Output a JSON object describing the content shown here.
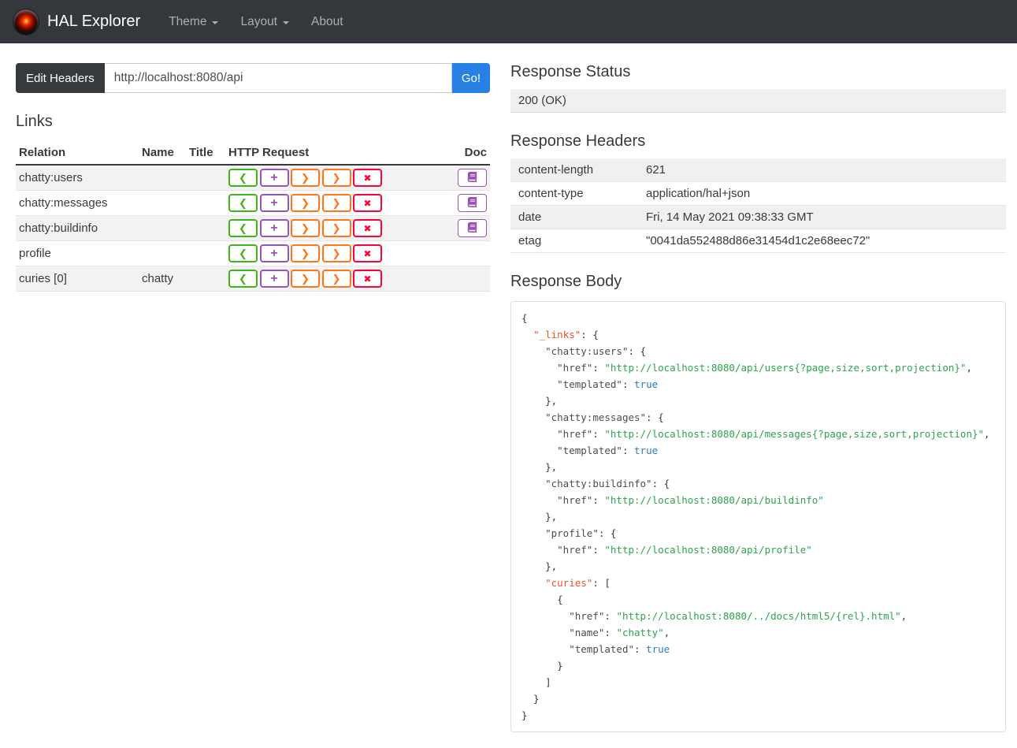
{
  "navbar": {
    "brand": "HAL Explorer",
    "items": [
      {
        "label": "Theme",
        "has_caret": true
      },
      {
        "label": "Layout",
        "has_caret": true
      },
      {
        "label": "About",
        "has_caret": false
      }
    ]
  },
  "url_bar": {
    "edit_headers_label": "Edit Headers",
    "url_value": "http://localhost:8080/api",
    "go_label": "Go!"
  },
  "links_section": {
    "title": "Links",
    "columns": {
      "relation": "Relation",
      "name": "Name",
      "title": "Title",
      "http_request": "HTTP Request",
      "doc": "Doc"
    },
    "request_buttons": [
      {
        "name": "get",
        "glyph": "❮",
        "color": "#3fb618"
      },
      {
        "name": "post",
        "glyph": "+",
        "color": "#9954bb"
      },
      {
        "name": "put",
        "glyph": "❯",
        "color": "#ff7518"
      },
      {
        "name": "patch",
        "glyph": "❯",
        "color": "#ff7518"
      },
      {
        "name": "delete",
        "glyph": "✖",
        "color": "#ff0039"
      }
    ],
    "doc_button": {
      "icon": "book-icon",
      "color": "#9954bb"
    },
    "rows": [
      {
        "relation": "chatty:users",
        "name": "",
        "title": "",
        "has_doc": true
      },
      {
        "relation": "chatty:messages",
        "name": "",
        "title": "",
        "has_doc": true
      },
      {
        "relation": "chatty:buildinfo",
        "name": "",
        "title": "",
        "has_doc": true
      },
      {
        "relation": "profile",
        "name": "",
        "title": "",
        "has_doc": false
      },
      {
        "relation": "curies [0]",
        "name": "chatty",
        "title": "",
        "has_doc": false
      }
    ]
  },
  "response_status": {
    "title": "Response Status",
    "value": "200 (OK)"
  },
  "response_headers": {
    "title": "Response Headers",
    "rows": [
      [
        "content-length",
        "621"
      ],
      [
        "content-type",
        "application/hal+json"
      ],
      [
        "date",
        "Fri, 14 May 2021 09:38:33 GMT"
      ],
      [
        "etag",
        "\"0041da552488d86e31454d1c2e68eec72\""
      ]
    ]
  },
  "response_body": {
    "title": "Response Body",
    "lines": [
      [
        [
          "p",
          "{"
        ]
      ],
      [
        [
          "p",
          "  "
        ],
        [
          "h",
          "\"_links\""
        ],
        [
          "p",
          ": {"
        ]
      ],
      [
        [
          "p",
          "    "
        ],
        [
          "k",
          "\"chatty:users\""
        ],
        [
          "p",
          ": {"
        ]
      ],
      [
        [
          "p",
          "      "
        ],
        [
          "k",
          "\"href\""
        ],
        [
          "p",
          ": "
        ],
        [
          "s",
          "\"http://localhost:8080/api/users{?page,size,sort,projection}\""
        ],
        [
          "p",
          ","
        ]
      ],
      [
        [
          "p",
          "      "
        ],
        [
          "k",
          "\"templated\""
        ],
        [
          "p",
          ": "
        ],
        [
          "b",
          "true"
        ]
      ],
      [
        [
          "p",
          "    },"
        ]
      ],
      [
        [
          "p",
          "    "
        ],
        [
          "k",
          "\"chatty:messages\""
        ],
        [
          "p",
          ": {"
        ]
      ],
      [
        [
          "p",
          "      "
        ],
        [
          "k",
          "\"href\""
        ],
        [
          "p",
          ": "
        ],
        [
          "s",
          "\"http://localhost:8080/api/messages{?page,size,sort,projection}\""
        ],
        [
          "p",
          ","
        ]
      ],
      [
        [
          "p",
          "      "
        ],
        [
          "k",
          "\"templated\""
        ],
        [
          "p",
          ": "
        ],
        [
          "b",
          "true"
        ]
      ],
      [
        [
          "p",
          "    },"
        ]
      ],
      [
        [
          "p",
          "    "
        ],
        [
          "k",
          "\"chatty:buildinfo\""
        ],
        [
          "p",
          ": {"
        ]
      ],
      [
        [
          "p",
          "      "
        ],
        [
          "k",
          "\"href\""
        ],
        [
          "p",
          ": "
        ],
        [
          "s",
          "\"http://localhost:8080/api/buildinfo\""
        ]
      ],
      [
        [
          "p",
          "    },"
        ]
      ],
      [
        [
          "p",
          "    "
        ],
        [
          "k",
          "\"profile\""
        ],
        [
          "p",
          ": {"
        ]
      ],
      [
        [
          "p",
          "      "
        ],
        [
          "k",
          "\"href\""
        ],
        [
          "p",
          ": "
        ],
        [
          "s",
          "\"http://localhost:8080/api/profile\""
        ]
      ],
      [
        [
          "p",
          "    },"
        ]
      ],
      [
        [
          "p",
          "    "
        ],
        [
          "h",
          "\"curies\""
        ],
        [
          "p",
          ": ["
        ]
      ],
      [
        [
          "p",
          "      {"
        ]
      ],
      [
        [
          "p",
          "        "
        ],
        [
          "k",
          "\"href\""
        ],
        [
          "p",
          ": "
        ],
        [
          "s",
          "\"http://localhost:8080/../docs/html5/{rel}.html\""
        ],
        [
          "p",
          ","
        ]
      ],
      [
        [
          "p",
          "        "
        ],
        [
          "k",
          "\"name\""
        ],
        [
          "p",
          ": "
        ],
        [
          "s",
          "\"chatty\""
        ],
        [
          "p",
          ","
        ]
      ],
      [
        [
          "p",
          "        "
        ],
        [
          "k",
          "\"templated\""
        ],
        [
          "p",
          ": "
        ],
        [
          "b",
          "true"
        ]
      ],
      [
        [
          "p",
          "      }"
        ]
      ],
      [
        [
          "p",
          "    ]"
        ]
      ],
      [
        [
          "p",
          "  }"
        ]
      ],
      [
        [
          "p",
          "}"
        ]
      ]
    ]
  },
  "colors": {
    "navbar_bg": "#34383c",
    "primary_blue": "#2780e3",
    "get_green": "#3fb618",
    "post_purple": "#9954bb",
    "put_patch_orange": "#ff7518",
    "delete_red": "#ff0039",
    "stripe_gray": "#f2f2f2",
    "json_hal_key": "#e95420",
    "json_string": "#2da44e",
    "json_bool": "#2b7bb9"
  }
}
